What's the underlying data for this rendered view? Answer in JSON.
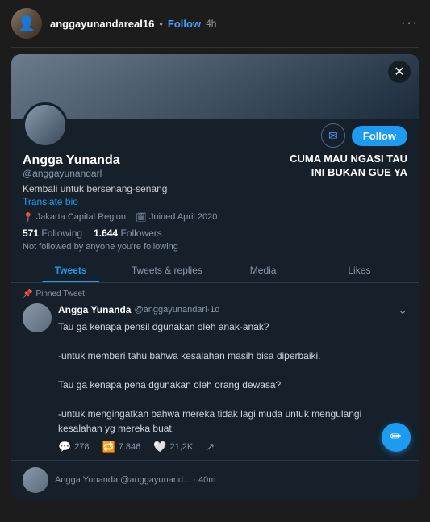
{
  "ig_header": {
    "username": "anggayunandareal16",
    "dot": "•",
    "follow_label": "Follow",
    "time": "4h",
    "more_icon": "···"
  },
  "twitter_card": {
    "close_icon": "✕",
    "banner_alt": "profile banner",
    "profile": {
      "display_name": "Angga Yunanda",
      "handle": "@anggayunandarl",
      "tagline_line1": "CUMA MAU NGASI TAU",
      "tagline_line2": "INI BUKAN GUE YA",
      "bio": "Kembali untuk bersenang-senang",
      "translate_label": "Translate bio",
      "location": "Jakarta Capital Region",
      "joined": "Joined April 2020",
      "following_count": "571",
      "following_label": "Following",
      "followers_count": "1.644",
      "followers_label": "Followers",
      "not_followed_text": "Not followed by anyone you're following"
    },
    "action_buttons": {
      "message_icon": "✉",
      "follow_label": "Follow"
    },
    "tabs": [
      {
        "label": "Tweets",
        "active": true
      },
      {
        "label": "Tweets & replies",
        "active": false
      },
      {
        "label": "Media",
        "active": false
      },
      {
        "label": "Likes",
        "active": false
      }
    ],
    "pinned_tweet": {
      "pinned_label": "Pinned Tweet",
      "author_name": "Angga Yunanda",
      "author_handle": "@anggayunandarl",
      "time_ago": "1d",
      "text_line1": "Tau ga kenapa pensil dgunakan oleh anak-anak?",
      "text_line2": "-untuk memberi tahu bahwa kesalahan masih bisa diperbaiki.",
      "text_line3": "Tau ga kenapa pena dgunakan oleh orang dewasa?",
      "text_line4": "-untuk mengingatkan bahwa mereka tidak lagi muda untuk mengulangi kesalahan yg mereka buat.",
      "actions": {
        "replies": "278",
        "retweets": "7.846",
        "likes": "21,2K"
      },
      "reply_icon": "↩"
    },
    "next_tweet_preview": {
      "author_name": "Angga Yunanda",
      "handle": "@anggayunand...",
      "time_ago": "40m"
    }
  }
}
